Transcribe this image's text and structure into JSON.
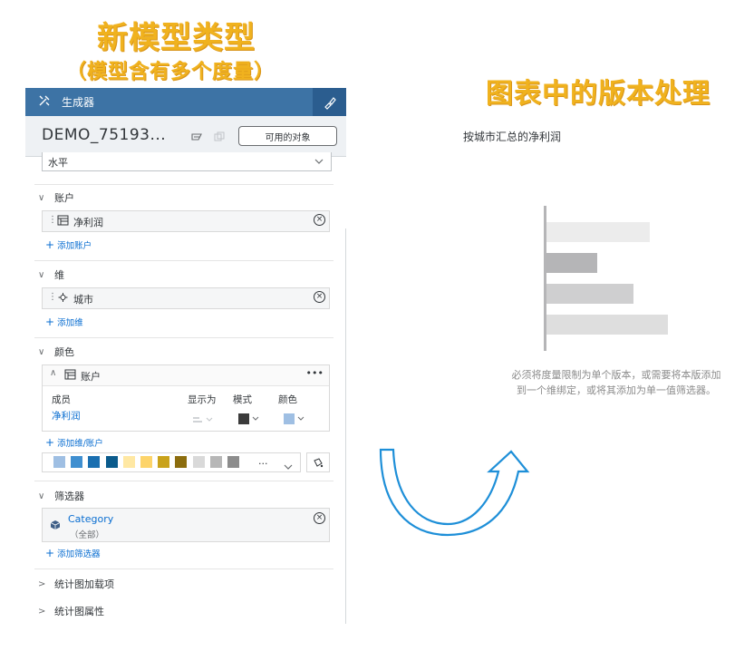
{
  "headline_left": "新模型类型",
  "subheadline_left": "（模型含有多个度量）",
  "headline_right": "图表中的版本处理",
  "topbar": {
    "tab_label": "生成器"
  },
  "model": {
    "name": "DEMO_75193...",
    "available_objects_button": "可用的对象"
  },
  "orientation_select": "水平",
  "accounts": {
    "title": "账户",
    "token": "净利润",
    "add": "添加账户"
  },
  "dimensions": {
    "title": "维",
    "token": "城市",
    "add": "添加维"
  },
  "color": {
    "title": "颜色",
    "card_title": "账户",
    "columns": {
      "member": "成员",
      "display_as": "显示为",
      "pattern": "模式",
      "color": "颜色"
    },
    "row_member": "净利润",
    "pattern_color": "#3b3b3b",
    "row_color": "#9fbfe3",
    "add": "添加维/账户",
    "palette": [
      "#9fbfe3",
      "#3f8fd0",
      "#1a6fb0",
      "#0b5b8c",
      "#ffe8a3",
      "#fdd46a",
      "#c9a21a",
      "#8c6d0e",
      "#d9d9d9",
      "#b7b7b7",
      "#8c8c8c"
    ],
    "palette_more": "..."
  },
  "filters": {
    "title": "筛选器",
    "token": "Category",
    "token_sub": "（全部）",
    "add": "添加筛选器"
  },
  "collapsed_sections": [
    "统计图加载项",
    "统计图属性"
  ],
  "chart": {
    "title": "按城市汇总的净利润",
    "message_line1": "必须将度量限制为单个版本，或需要将本版添加",
    "message_line2": "到一个维绑定，或将其添加为单一值筛选器。"
  },
  "chart_data": {
    "type": "bar",
    "orientation": "horizontal",
    "placeholder": true,
    "values": [
      0.85,
      0.42,
      0.72,
      1.0
    ],
    "colors": [
      "#ececec",
      "#b5b5b7",
      "#cfcfd0",
      "#dedede"
    ]
  },
  "arrow_color": "#1e8fd8"
}
